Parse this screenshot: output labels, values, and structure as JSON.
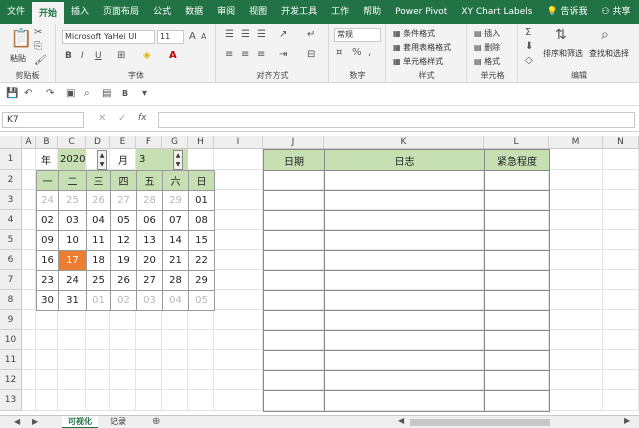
{
  "ribbon_tabs": [
    "文件",
    "开始",
    "插入",
    "页面布局",
    "公式",
    "数据",
    "审阅",
    "视图",
    "开发工具",
    "工作",
    "帮助",
    "Power Pivot",
    "XY Chart Labels"
  ],
  "tell_me": "告诉我",
  "share": "共享",
  "ribbon": {
    "paste": "粘贴",
    "clipboard": "剪贴板",
    "font_name": "Microsoft YaHei UI",
    "font_size": "11",
    "font": "字体",
    "alignment": "对齐方式",
    "number_format": "常规",
    "number": "数字",
    "cond_format": "条件格式",
    "table_format": "套用表格格式",
    "cell_style": "单元格样式",
    "styles": "样式",
    "insert": "插入",
    "delete": "删除",
    "format": "格式",
    "cells": "单元格",
    "sort_filter": "排序和筛选",
    "find_select": "查找和选择",
    "editing": "编辑",
    "bold": "B",
    "italic": "I",
    "underline": "U",
    "qat_bold": "B"
  },
  "name_box": "K7",
  "fx": "fx",
  "columns": [
    "A",
    "B",
    "C",
    "D",
    "E",
    "F",
    "G",
    "H",
    "I",
    "J",
    "K",
    "L",
    "M",
    "N"
  ],
  "rows": [
    "1",
    "2",
    "3",
    "4",
    "5",
    "6",
    "7",
    "8",
    "9",
    "10",
    "11",
    "12",
    "13"
  ],
  "calendar": {
    "year_label": "年",
    "year": "2020",
    "month_label": "月",
    "month": "3",
    "weekdays": [
      "一",
      "二",
      "三",
      "四",
      "五",
      "六",
      "日"
    ],
    "weeks": [
      [
        "24",
        "25",
        "26",
        "27",
        "28",
        "29",
        "01"
      ],
      [
        "02",
        "03",
        "04",
        "05",
        "06",
        "07",
        "08"
      ],
      [
        "09",
        "10",
        "11",
        "12",
        "13",
        "14",
        "15"
      ],
      [
        "16",
        "17",
        "18",
        "19",
        "20",
        "21",
        "22"
      ],
      [
        "23",
        "24",
        "25",
        "26",
        "27",
        "28",
        "29"
      ],
      [
        "30",
        "31",
        "01",
        "02",
        "03",
        "04",
        "05"
      ]
    ],
    "today": "17",
    "colors": {
      "header": "#c6e0b4",
      "today": "#ed7d31",
      "other_month": "#b8b8b8"
    }
  },
  "log_table": {
    "headers": [
      "日期",
      "日志",
      "紧急程度"
    ]
  },
  "sheet_tabs": [
    "可视化",
    "记录"
  ],
  "accent": "#217346"
}
